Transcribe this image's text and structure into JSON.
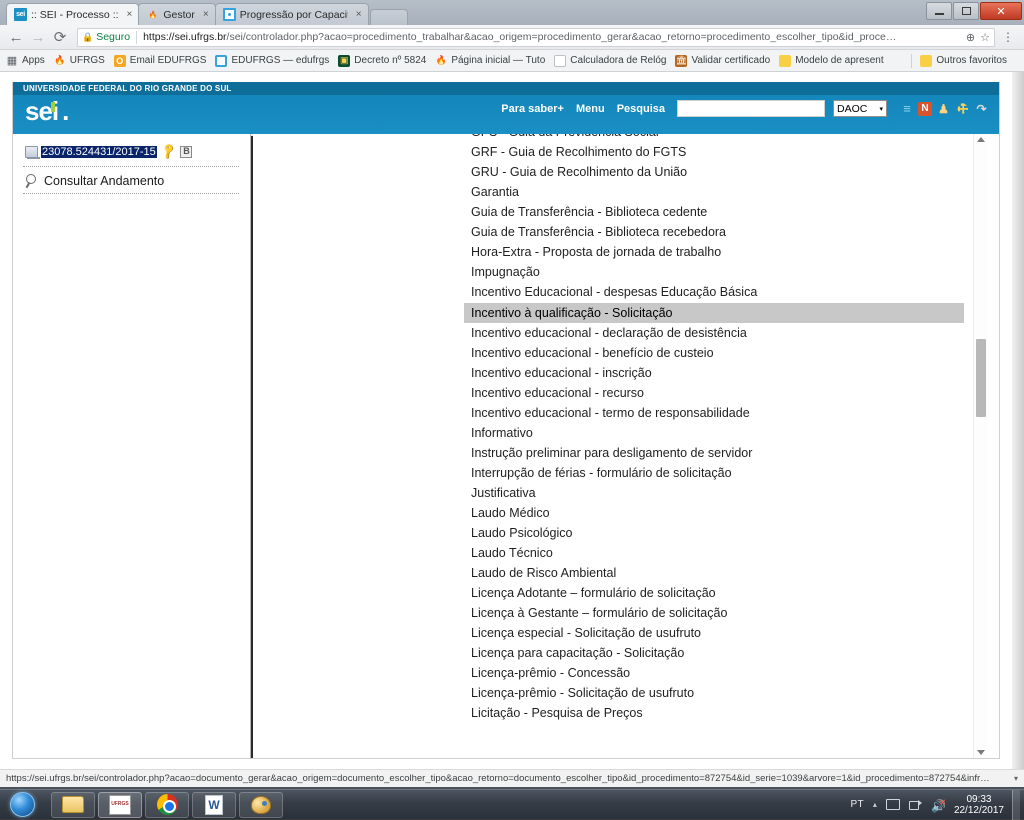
{
  "browser": {
    "tabs": [
      {
        "title": ":: SEI - Processo ::",
        "icon": "sei-favicon",
        "active": true,
        "close_label": "×"
      },
      {
        "title": "Gestor",
        "icon": "flame-favicon",
        "active": false,
        "close_label": "×"
      },
      {
        "title": "Progressão por Capacita",
        "icon": "circle-favicon",
        "active": false,
        "close_label": "×"
      }
    ],
    "window_controls": {
      "minimize": "–",
      "maximize": "❐",
      "close": "✕"
    },
    "nav": {
      "back": "←",
      "forward": "→",
      "reload": "⟳"
    },
    "omnibox": {
      "secure_label": "Seguro",
      "url_host": "https://sei.ufrgs.br",
      "url_path": "/sei/controlador.php?acao=procedimento_trabalhar&acao_origem=procedimento_gerar&acao_retorno=procedimento_escolher_tipo&id_proce…",
      "zoom_icon": "⊕",
      "star_icon": "☆",
      "menu_icon": "⋮"
    },
    "bookmarks": [
      {
        "label": "Apps",
        "icon": "apps-grid-icon"
      },
      {
        "label": "UFRGS",
        "icon": "flame-icon"
      },
      {
        "label": "Email EDUFRGS",
        "icon": "orange-circle-icon"
      },
      {
        "label": "EDUFRGS — edufrgs",
        "icon": "blue-circle-icon"
      },
      {
        "label": "Decreto nº 5824",
        "icon": "dark-doc-icon"
      },
      {
        "label": "Página inicial — Tuto",
        "icon": "flame-icon"
      },
      {
        "label": "Calculadora de Relóg",
        "icon": "page-icon"
      },
      {
        "label": "Validar certificado",
        "icon": "brown-icon"
      },
      {
        "label": "Modelo de apresent",
        "icon": "yellow-icon"
      }
    ],
    "bookmarks_right": {
      "label": "Outros favoritos",
      "icon": "folder-icon"
    },
    "status_url": "https://sei.ufrgs.br/sei/controlador.php?acao=documento_gerar&acao_origem=documento_escolher_tipo&acao_retorno=documento_escolher_tipo&id_procedimento=872754&id_serie=1039&arvore=1&id_procedimento=872754&infr…",
    "status_caret": "▾"
  },
  "sei": {
    "org_name": "UNIVERSIDADE FEDERAL DO RIO GRANDE DO SUL",
    "logo_text": "sei",
    "logo_dot": ".",
    "toolbar": {
      "links": [
        "Para saber+",
        "Menu",
        "Pesquisa"
      ],
      "search_value": "",
      "unit_selected": "DAOC",
      "unit_caret": "▾",
      "icons": [
        {
          "name": "menu-list-icon",
          "glyph": "≡"
        },
        {
          "name": "notifications-icon",
          "glyph": "N"
        },
        {
          "name": "user-icon",
          "glyph": "♟"
        },
        {
          "name": "wrench-icon",
          "glyph": "⚒"
        },
        {
          "name": "logout-icon",
          "glyph": "↷"
        }
      ]
    },
    "sidebar": {
      "process_number": "23078.524431/2017-15",
      "process_icon": "process-folder-icon",
      "key_icon": "key-icon",
      "b_badge": "B",
      "consult_label": "Consultar Andamento",
      "consult_icon": "magnifier-icon"
    },
    "document_list": {
      "selected_index": 9,
      "items": [
        {
          "label": "GPS - Guia da Previdência Social",
          "clipped_top": true
        },
        {
          "label": "GRF - Guia de Recolhimento do FGTS"
        },
        {
          "label": "GRU - Guia de Recolhimento da União"
        },
        {
          "label": "Garantia"
        },
        {
          "label": "Guia de Transferência - Biblioteca cedente"
        },
        {
          "label": "Guia de Transferência - Biblioteca recebedora"
        },
        {
          "label": "Hora-Extra - Proposta de jornada de trabalho"
        },
        {
          "label": "Impugnação"
        },
        {
          "label": "Incentivo Educacional - despesas Educação Básica",
          "wrap": true
        },
        {
          "label": "Incentivo à qualificação - Solicitação"
        },
        {
          "label": "Incentivo educacional - declaração de desistência"
        },
        {
          "label": "Incentivo educacional - benefício de custeio"
        },
        {
          "label": "Incentivo educacional - inscrição"
        },
        {
          "label": "Incentivo educacional - recurso"
        },
        {
          "label": "Incentivo educacional - termo de responsabilidade"
        },
        {
          "label": "Informativo"
        },
        {
          "label": "Instrução preliminar para desligamento de servidor",
          "wrap": true
        },
        {
          "label": "Interrupção de férias - formulário de solicitação"
        },
        {
          "label": "Justificativa"
        },
        {
          "label": "Laudo Médico"
        },
        {
          "label": "Laudo Psicológico"
        },
        {
          "label": "Laudo Técnico"
        },
        {
          "label": "Laudo de Risco Ambiental"
        },
        {
          "label": "Licença Adotante – formulário de solicitação"
        },
        {
          "label": "Licença à Gestante – formulário de solicitação"
        },
        {
          "label": "Licença especial - Solicitação de usufruto"
        },
        {
          "label": "Licença para capacitação - Solicitação"
        },
        {
          "label": "Licença-prêmio - Concessão"
        },
        {
          "label": "Licença-prêmio - Solicitação de usufruto"
        },
        {
          "label": "Licitação - Pesquisa de Preços"
        }
      ]
    }
  },
  "taskbar": {
    "start_label": "start-orb",
    "items": [
      {
        "name": "explorer",
        "icon": "folder-icon",
        "state": "glass"
      },
      {
        "name": "ufrgs-doc",
        "icon": "ufrgs-icon",
        "state": "pressed"
      },
      {
        "name": "chrome",
        "icon": "chrome-icon",
        "state": "glass"
      },
      {
        "name": "word",
        "icon": "word-icon",
        "state": "glass"
      },
      {
        "name": "paint",
        "icon": "paint-icon",
        "state": "glass"
      }
    ],
    "tray": {
      "language": "PT",
      "overflow_arrow": "▴",
      "icons": [
        "monitor-icon",
        "network-icon",
        "volume-muted-icon"
      ],
      "time": "09:33",
      "date": "22/12/2017"
    }
  }
}
